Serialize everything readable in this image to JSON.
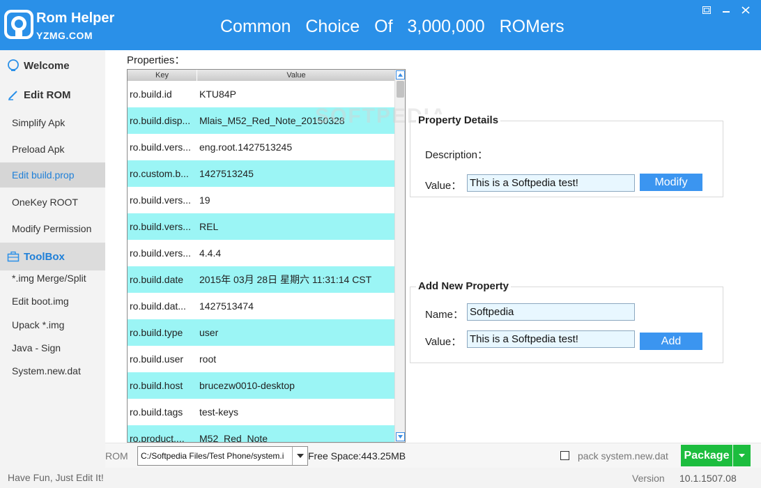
{
  "header": {
    "app_title": "Rom Helper",
    "app_subtitle": "YZMG.COM",
    "slogan": "Common  Choice  Of  3,000,000  ROMers"
  },
  "window_controls": [
    "restore-icon",
    "minimize-icon",
    "close-icon"
  ],
  "sidebar": {
    "welcome": "Welcome",
    "edit_rom": "Edit ROM",
    "items": [
      {
        "label": "Simplify Apk"
      },
      {
        "label": "Preload Apk"
      },
      {
        "label": "Edit build.prop",
        "active": true
      },
      {
        "label": "OneKey ROOT"
      },
      {
        "label": "Modify Permission"
      }
    ],
    "toolbox": "ToolBox",
    "tools": [
      {
        "label": "*.img Merge/Split"
      },
      {
        "label": "Edit boot.img"
      },
      {
        "label": "Upack  *.img"
      },
      {
        "label": "Java - Sign"
      },
      {
        "label": "System.new.dat"
      }
    ]
  },
  "properties": {
    "label": "Properties：",
    "columns": {
      "key": "Key",
      "value": "Value"
    },
    "rows": [
      {
        "key": "ro.build.id",
        "value": "KTU84P"
      },
      {
        "key": "ro.build.disp...",
        "value": "Mlais_M52_Red_Note_20150328"
      },
      {
        "key": "ro.build.vers...",
        "value": "eng.root.1427513245"
      },
      {
        "key": "ro.custom.b...",
        "value": "1427513245"
      },
      {
        "key": "ro.build.vers...",
        "value": "19"
      },
      {
        "key": "ro.build.vers...",
        "value": "REL"
      },
      {
        "key": "ro.build.vers...",
        "value": "4.4.4"
      },
      {
        "key": "ro.build.date",
        "value": "2015年 03月 28日 星期六 11:31:14 CST"
      },
      {
        "key": "ro.build.dat...",
        "value": "1427513474"
      },
      {
        "key": "ro.build.type",
        "value": "user"
      },
      {
        "key": "ro.build.user",
        "value": "root"
      },
      {
        "key": "ro.build.host",
        "value": "brucezw0010-desktop"
      },
      {
        "key": "ro.build.tags",
        "value": "test-keys"
      },
      {
        "key": "ro.product....",
        "value": "M52_Red_Note"
      }
    ]
  },
  "property_details": {
    "title": "Property Details",
    "description_label": "Description：",
    "value_label": "Value：",
    "value": "This is a Softpedia test!",
    "modify_button": "Modify"
  },
  "add_property": {
    "title": "Add New Property",
    "name_label": "Name：",
    "name_value": "Softpedia",
    "value_label": "Value：",
    "value": "This is a Softpedia test!",
    "add_button": "Add"
  },
  "bottombar": {
    "rom_label": "ROM",
    "rom_path": "C:/Softpedia Files/Test Phone/system.i",
    "free_space": "Free Space:443.25MB",
    "pack_label": "pack system.new.dat",
    "pack_checked": false,
    "package_button": "Package"
  },
  "statusbar": {
    "left_text": "Have Fun, Just Edit It!",
    "version_label": "Version",
    "version": "10.1.1507.08"
  },
  "watermark": "SOFTPEDIA",
  "colors": {
    "header": "#2a90e8",
    "row_highlight": "#9bf5f5",
    "button_blue": "#3b95f0",
    "package_green": "#1cbd3e",
    "active_text": "#1e7fd8"
  }
}
